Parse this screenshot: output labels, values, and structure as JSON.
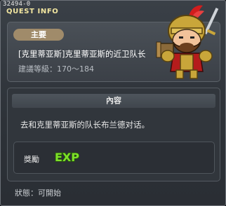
{
  "window": {
    "quest_id": "32494-0",
    "title": "QUEST INFO"
  },
  "quest": {
    "badge_label": "主要",
    "name": "[克里蒂亚斯]克里蒂亚斯的近卫队长",
    "level_range": "建議等級：170～184"
  },
  "content": {
    "header": "內容",
    "text": "去和克里蒂亚斯的队长布兰德对话。"
  },
  "reward": {
    "label": "獎勵",
    "exp_text": "EXP"
  },
  "status": {
    "text": "狀態：可開始"
  },
  "icons": {
    "npc": "armored-knight-npc-icon",
    "exp": "exp-icon"
  },
  "colors": {
    "badge": "#a08b6a",
    "title": "#f2e6a0",
    "exp": "#7ee02a"
  }
}
